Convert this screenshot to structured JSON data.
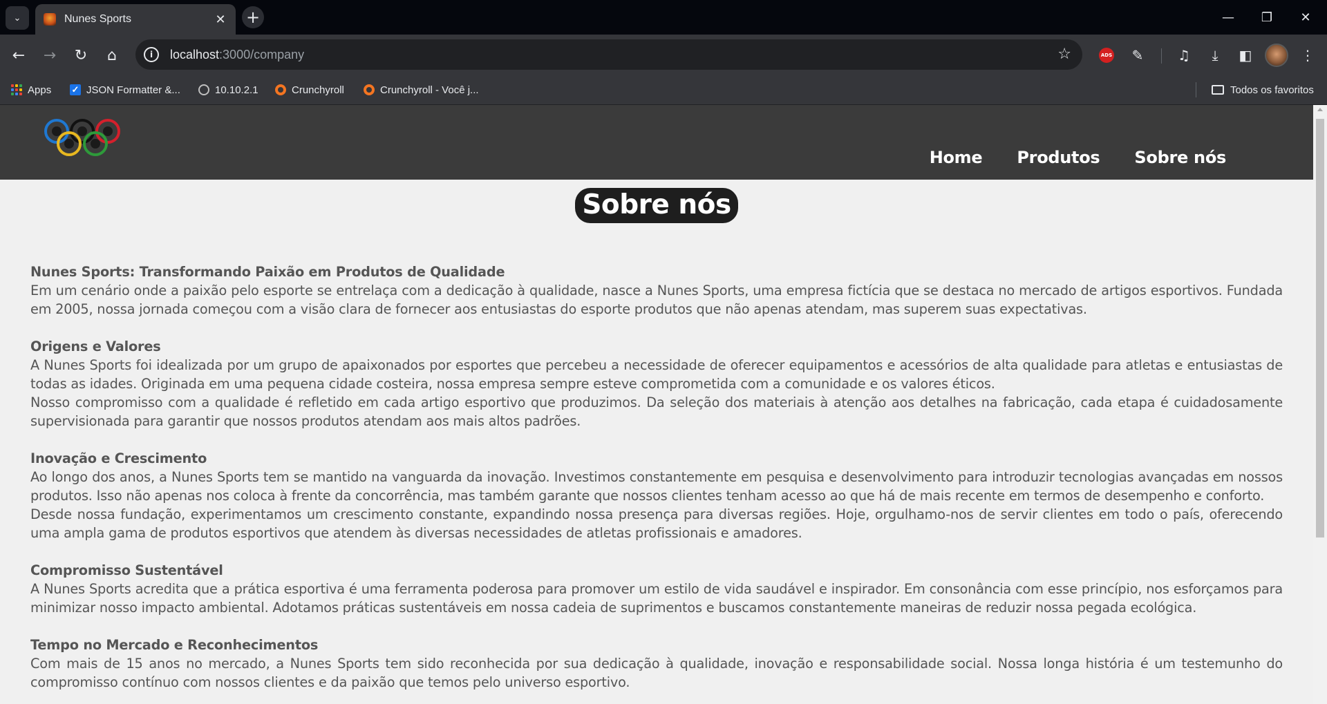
{
  "browser": {
    "tab_title": "Nunes Sports",
    "url_host": "localhost",
    "url_path": ":3000/company",
    "bookmarks": [
      {
        "label": "Apps",
        "icon": "apps-grid-icon"
      },
      {
        "label": "JSON Formatter &...",
        "icon": "checkbox-icon"
      },
      {
        "label": "10.10.2.1",
        "icon": "globe-icon"
      },
      {
        "label": "Crunchyroll",
        "icon": "crunchyroll-icon"
      },
      {
        "label": "Crunchyroll - Você j...",
        "icon": "crunchyroll-icon"
      }
    ],
    "all_bookmarks_label": "Todos os favoritos"
  },
  "site": {
    "nav": [
      {
        "label": "Home"
      },
      {
        "label": "Produtos"
      },
      {
        "label": "Sobre nós"
      }
    ],
    "page_title": "Sobre nós",
    "sections": [
      {
        "heading": "Nunes Sports: Transformando Paixão em Produtos de Qualidade",
        "paragraphs": [
          "Em um cenário onde a paixão pelo esporte se entrelaça com a dedicação à qualidade, nasce a Nunes Sports, uma empresa fictícia que se destaca no mercado de artigos esportivos. Fundada em 2005, nossa jornada começou com a visão clara de fornecer aos entusiastas do esporte produtos que não apenas atendam, mas superem suas expectativas."
        ]
      },
      {
        "heading": "Origens e Valores",
        "paragraphs": [
          "A Nunes Sports foi idealizada por um grupo de apaixonados por esportes que percebeu a necessidade de oferecer equipamentos e acessórios de alta qualidade para atletas e entusiastas de todas as idades. Originada em uma pequena cidade costeira, nossa empresa sempre esteve comprometida com a comunidade e os valores éticos.",
          "Nosso compromisso com a qualidade é refletido em cada artigo esportivo que produzimos. Da seleção dos materiais à atenção aos detalhes na fabricação, cada etapa é cuidadosamente supervisionada para garantir que nossos produtos atendam aos mais altos padrões."
        ]
      },
      {
        "heading": "Inovação e Crescimento",
        "paragraphs": [
          "Ao longo dos anos, a Nunes Sports tem se mantido na vanguarda da inovação. Investimos constantemente em pesquisa e desenvolvimento para introduzir tecnologias avançadas em nossos produtos. Isso não apenas nos coloca à frente da concorrência, mas também garante que nossos clientes tenham acesso ao que há de mais recente em termos de desempenho e conforto.",
          "Desde nossa fundação, experimentamos um crescimento constante, expandindo nossa presença para diversas regiões. Hoje, orgulhamo-nos de servir clientes em todo o país, oferecendo uma ampla gama de produtos esportivos que atendem às diversas necessidades de atletas profissionais e amadores."
        ]
      },
      {
        "heading": "Compromisso Sustentável",
        "paragraphs": [
          "A Nunes Sports acredita que a prática esportiva é uma ferramenta poderosa para promover um estilo de vida saudável e inspirador. Em consonância com esse princípio, nos esforçamos para minimizar nosso impacto ambiental. Adotamos práticas sustentáveis em nossa cadeia de suprimentos e buscamos constantemente maneiras de reduzir nossa pegada ecológica."
        ]
      },
      {
        "heading": "Tempo no Mercado e Reconhecimentos",
        "paragraphs": [
          "Com mais de 15 anos no mercado, a Nunes Sports tem sido reconhecida por sua dedicação à qualidade, inovação e responsabilidade social. Nossa longa história é um testemunho do compromisso contínuo com nossos clientes e da paixão que temos pelo universo esportivo."
        ]
      }
    ]
  },
  "colors": {
    "header_bg": "#3b3b3b",
    "page_bg": "#f0f0f0",
    "title_pill_bg": "#1e1e1e",
    "body_text": "#555555"
  }
}
